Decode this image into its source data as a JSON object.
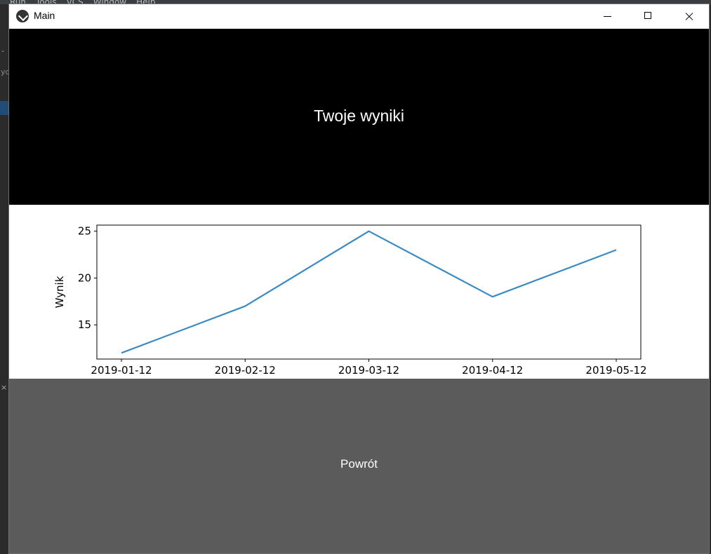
{
  "window": {
    "title": "Main"
  },
  "header": {
    "title": "Twoje wyniki"
  },
  "chart_data": {
    "type": "line",
    "x": [
      "2019-01-12",
      "2019-02-12",
      "2019-03-12",
      "2019-04-12",
      "2019-05-12"
    ],
    "values": [
      12,
      17,
      25,
      18,
      23
    ],
    "xlabel": "",
    "ylabel": "Wynik",
    "yticks": [
      15,
      20,
      25
    ],
    "ylim": [
      11.35,
      25.65
    ],
    "grid": false,
    "line_color": "#3a8ac4"
  },
  "back_button": {
    "label": "Powrót"
  }
}
